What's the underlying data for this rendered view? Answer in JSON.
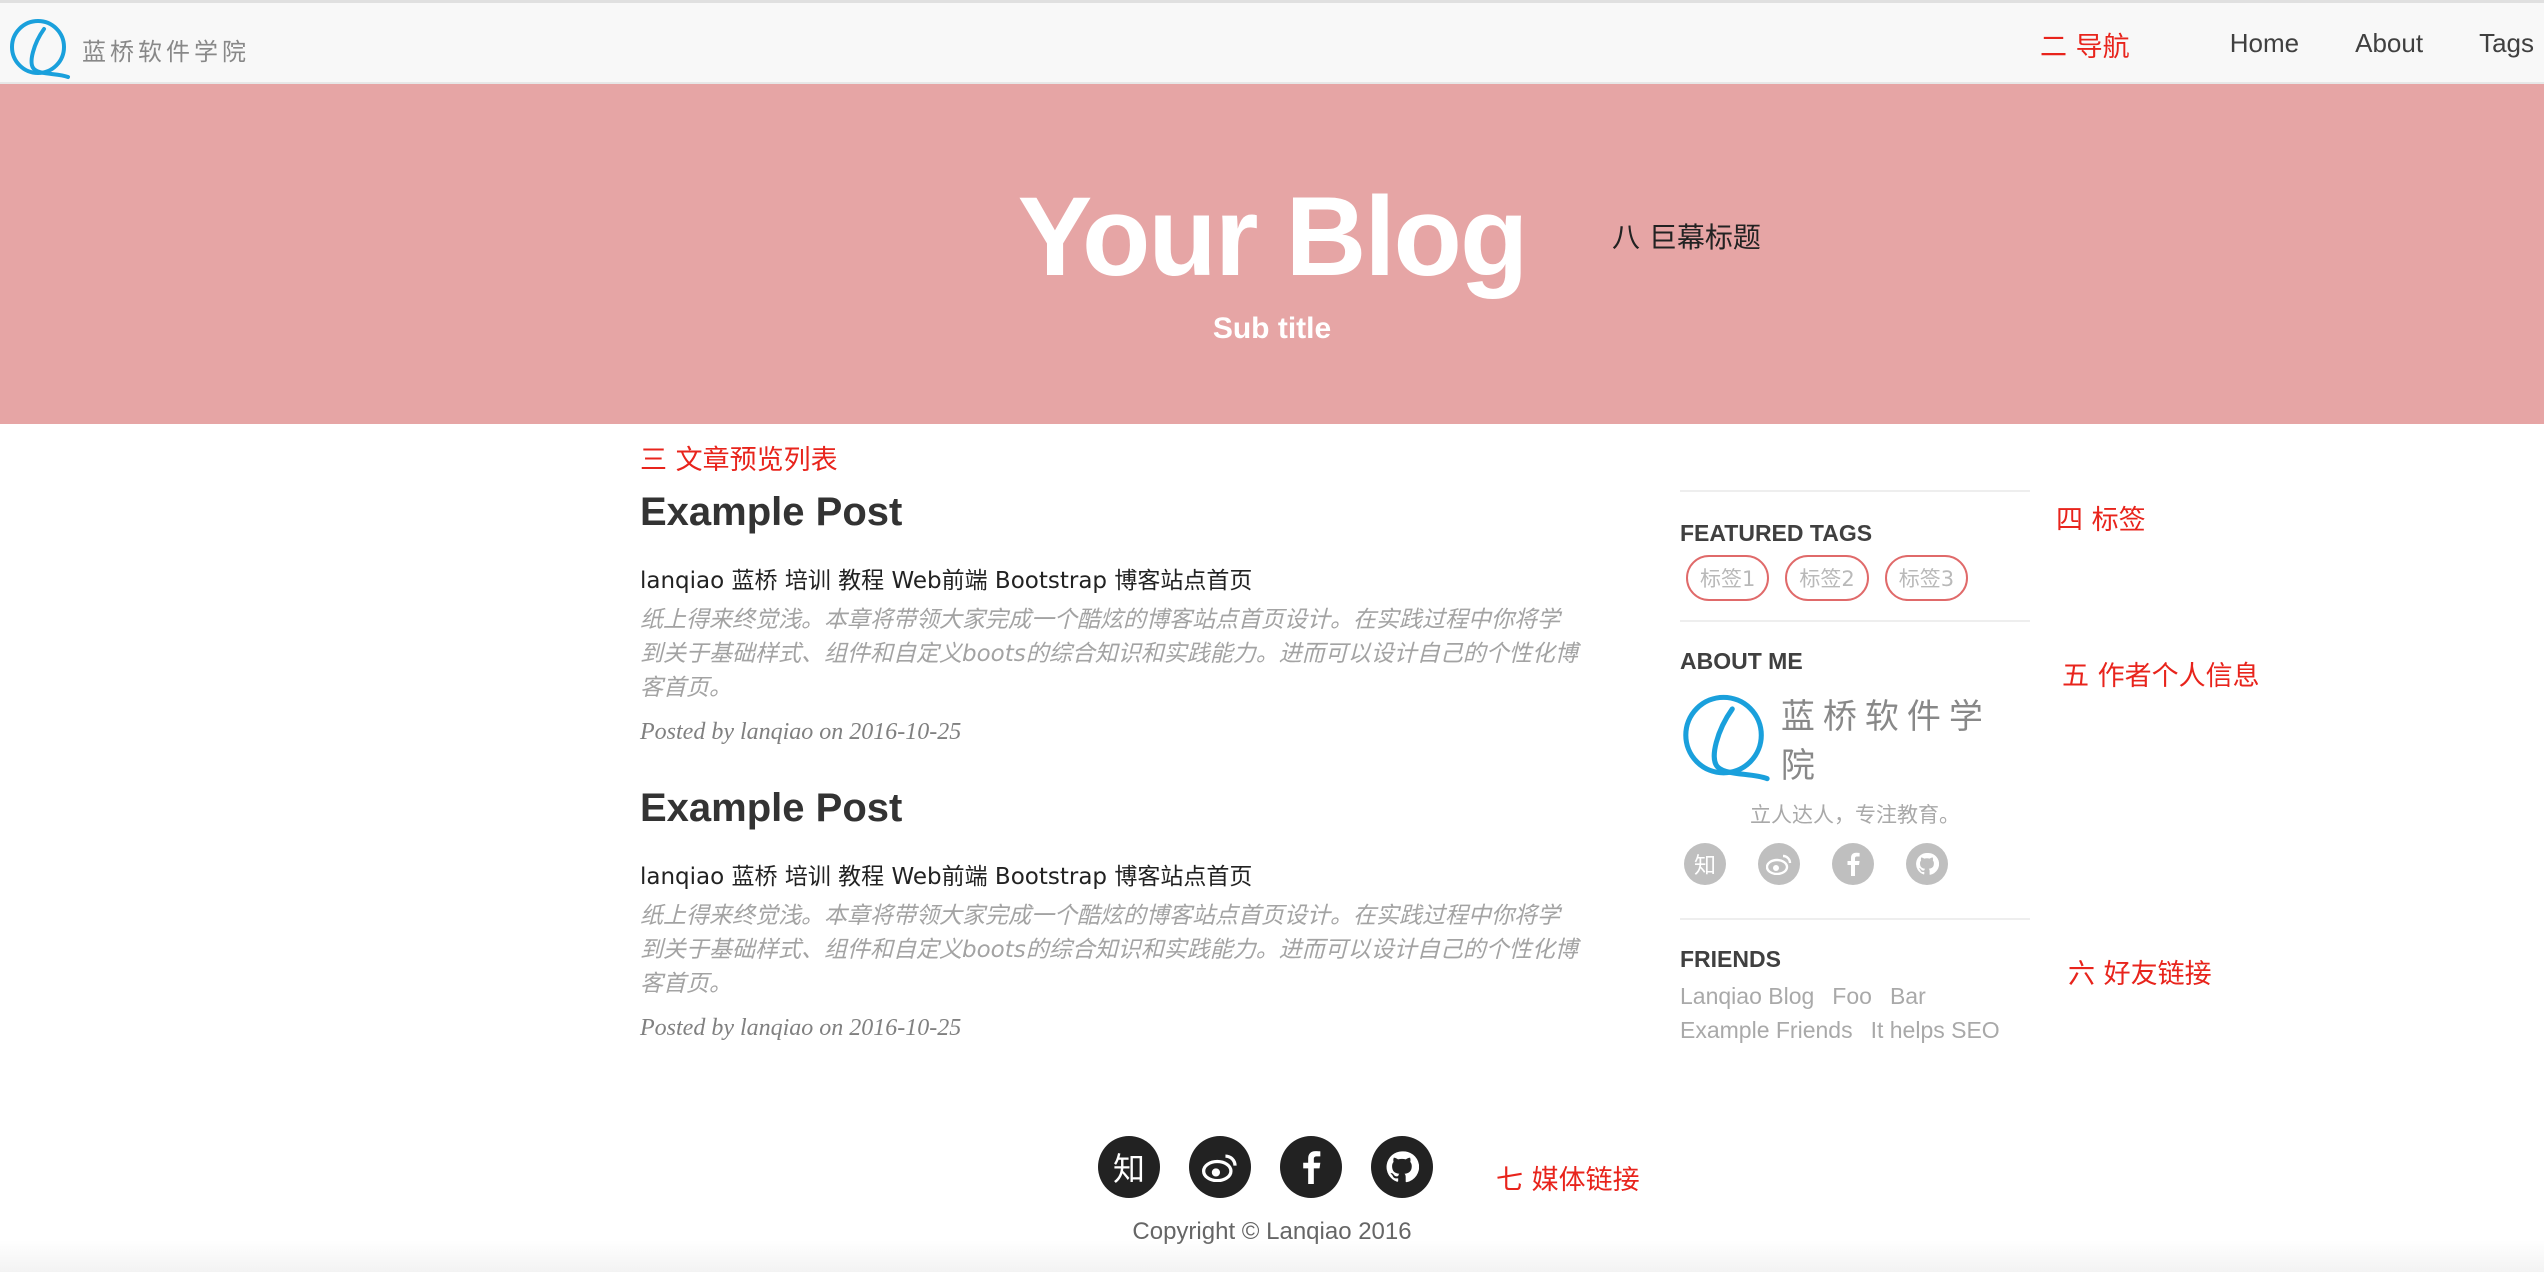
{
  "nav": {
    "brand_text": "蓝桥软件学院",
    "links": [
      "Home",
      "About",
      "Tags"
    ],
    "annotation": "二 导航"
  },
  "hero": {
    "title": "Your Blog",
    "subtitle": "Sub title",
    "annotation": "八 巨幕标题"
  },
  "posts": {
    "annotation": "三 文章预览列表",
    "items": [
      {
        "title": "Example Post",
        "subtitle": "lanqiao 蓝桥 培训 教程 Web前端 Bootstrap 博客站点首页",
        "excerpt": "纸上得来终觉浅。本章将带领大家完成一个酷炫的博客站点首页设计。在实践过程中你将学到关于基础样式、组件和自定义boots的综合知识和实践能力。进而可以设计自己的个性化博客首页。",
        "meta": "Posted by lanqiao on 2016-10-25"
      },
      {
        "title": "Example Post",
        "subtitle": "lanqiao 蓝桥 培训 教程 Web前端 Bootstrap 博客站点首页",
        "excerpt": "纸上得来终觉浅。本章将带领大家完成一个酷炫的博客站点首页设计。在实践过程中你将学到关于基础样式、组件和自定义boots的综合知识和实践能力。进而可以设计自己的个性化博客首页。",
        "meta": "Posted by lanqiao on 2016-10-25"
      }
    ]
  },
  "sidebar": {
    "tags": {
      "heading": "FEATURED TAGS",
      "items": [
        "标签1",
        "标签2",
        "标签3"
      ],
      "annotation": "四 标签"
    },
    "about": {
      "heading": "ABOUT ME",
      "brand_text": "蓝桥软件学院",
      "motto": "立人达人，专注教育。",
      "annotation": "五 作者个人信息",
      "social_icons": [
        "zhihu-icon",
        "weibo-icon",
        "facebook-icon",
        "github-icon"
      ]
    },
    "friends": {
      "heading": "FRIENDS",
      "items": [
        "Lanqiao Blog",
        "Foo",
        "Bar",
        "Example Friends",
        "It helps SEO"
      ],
      "annotation": "六 好友链接"
    }
  },
  "footer": {
    "social_icons": [
      "zhihu-icon",
      "weibo-icon",
      "facebook-icon",
      "github-icon"
    ],
    "zhihu_glyph": "知",
    "annotation": "七 媒体链接",
    "copyright": "Copyright © Lanqiao 2016"
  },
  "colors": {
    "hero_bg": "#e6a5a5",
    "annotation_red": "#e8241c",
    "brand_blue": "#1aa0dc",
    "tag_border": "#e06a6a"
  }
}
